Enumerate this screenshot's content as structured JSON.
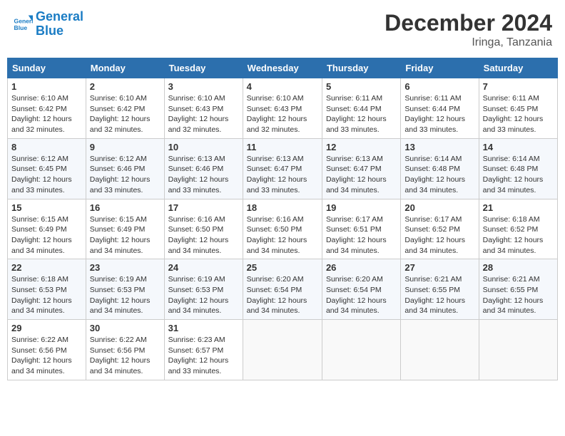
{
  "header": {
    "logo_line1": "General",
    "logo_line2": "Blue",
    "month": "December 2024",
    "location": "Iringa, Tanzania"
  },
  "columns": [
    "Sunday",
    "Monday",
    "Tuesday",
    "Wednesday",
    "Thursday",
    "Friday",
    "Saturday"
  ],
  "rows": [
    [
      {
        "day": "1",
        "sunrise": "6:10 AM",
        "sunset": "6:42 PM",
        "daylight": "12 hours and 32 minutes."
      },
      {
        "day": "2",
        "sunrise": "6:10 AM",
        "sunset": "6:42 PM",
        "daylight": "12 hours and 32 minutes."
      },
      {
        "day": "3",
        "sunrise": "6:10 AM",
        "sunset": "6:43 PM",
        "daylight": "12 hours and 32 minutes."
      },
      {
        "day": "4",
        "sunrise": "6:10 AM",
        "sunset": "6:43 PM",
        "daylight": "12 hours and 32 minutes."
      },
      {
        "day": "5",
        "sunrise": "6:11 AM",
        "sunset": "6:44 PM",
        "daylight": "12 hours and 33 minutes."
      },
      {
        "day": "6",
        "sunrise": "6:11 AM",
        "sunset": "6:44 PM",
        "daylight": "12 hours and 33 minutes."
      },
      {
        "day": "7",
        "sunrise": "6:11 AM",
        "sunset": "6:45 PM",
        "daylight": "12 hours and 33 minutes."
      }
    ],
    [
      {
        "day": "8",
        "sunrise": "6:12 AM",
        "sunset": "6:45 PM",
        "daylight": "12 hours and 33 minutes."
      },
      {
        "day": "9",
        "sunrise": "6:12 AM",
        "sunset": "6:46 PM",
        "daylight": "12 hours and 33 minutes."
      },
      {
        "day": "10",
        "sunrise": "6:13 AM",
        "sunset": "6:46 PM",
        "daylight": "12 hours and 33 minutes."
      },
      {
        "day": "11",
        "sunrise": "6:13 AM",
        "sunset": "6:47 PM",
        "daylight": "12 hours and 33 minutes."
      },
      {
        "day": "12",
        "sunrise": "6:13 AM",
        "sunset": "6:47 PM",
        "daylight": "12 hours and 34 minutes."
      },
      {
        "day": "13",
        "sunrise": "6:14 AM",
        "sunset": "6:48 PM",
        "daylight": "12 hours and 34 minutes."
      },
      {
        "day": "14",
        "sunrise": "6:14 AM",
        "sunset": "6:48 PM",
        "daylight": "12 hours and 34 minutes."
      }
    ],
    [
      {
        "day": "15",
        "sunrise": "6:15 AM",
        "sunset": "6:49 PM",
        "daylight": "12 hours and 34 minutes."
      },
      {
        "day": "16",
        "sunrise": "6:15 AM",
        "sunset": "6:49 PM",
        "daylight": "12 hours and 34 minutes."
      },
      {
        "day": "17",
        "sunrise": "6:16 AM",
        "sunset": "6:50 PM",
        "daylight": "12 hours and 34 minutes."
      },
      {
        "day": "18",
        "sunrise": "6:16 AM",
        "sunset": "6:50 PM",
        "daylight": "12 hours and 34 minutes."
      },
      {
        "day": "19",
        "sunrise": "6:17 AM",
        "sunset": "6:51 PM",
        "daylight": "12 hours and 34 minutes."
      },
      {
        "day": "20",
        "sunrise": "6:17 AM",
        "sunset": "6:52 PM",
        "daylight": "12 hours and 34 minutes."
      },
      {
        "day": "21",
        "sunrise": "6:18 AM",
        "sunset": "6:52 PM",
        "daylight": "12 hours and 34 minutes."
      }
    ],
    [
      {
        "day": "22",
        "sunrise": "6:18 AM",
        "sunset": "6:53 PM",
        "daylight": "12 hours and 34 minutes."
      },
      {
        "day": "23",
        "sunrise": "6:19 AM",
        "sunset": "6:53 PM",
        "daylight": "12 hours and 34 minutes."
      },
      {
        "day": "24",
        "sunrise": "6:19 AM",
        "sunset": "6:53 PM",
        "daylight": "12 hours and 34 minutes."
      },
      {
        "day": "25",
        "sunrise": "6:20 AM",
        "sunset": "6:54 PM",
        "daylight": "12 hours and 34 minutes."
      },
      {
        "day": "26",
        "sunrise": "6:20 AM",
        "sunset": "6:54 PM",
        "daylight": "12 hours and 34 minutes."
      },
      {
        "day": "27",
        "sunrise": "6:21 AM",
        "sunset": "6:55 PM",
        "daylight": "12 hours and 34 minutes."
      },
      {
        "day": "28",
        "sunrise": "6:21 AM",
        "sunset": "6:55 PM",
        "daylight": "12 hours and 34 minutes."
      }
    ],
    [
      {
        "day": "29",
        "sunrise": "6:22 AM",
        "sunset": "6:56 PM",
        "daylight": "12 hours and 34 minutes."
      },
      {
        "day": "30",
        "sunrise": "6:22 AM",
        "sunset": "6:56 PM",
        "daylight": "12 hours and 34 minutes."
      },
      {
        "day": "31",
        "sunrise": "6:23 AM",
        "sunset": "6:57 PM",
        "daylight": "12 hours and 33 minutes."
      },
      null,
      null,
      null,
      null
    ]
  ],
  "labels": {
    "sunrise_label": "Sunrise:",
    "sunset_label": "Sunset:",
    "daylight_label": "Daylight:"
  }
}
